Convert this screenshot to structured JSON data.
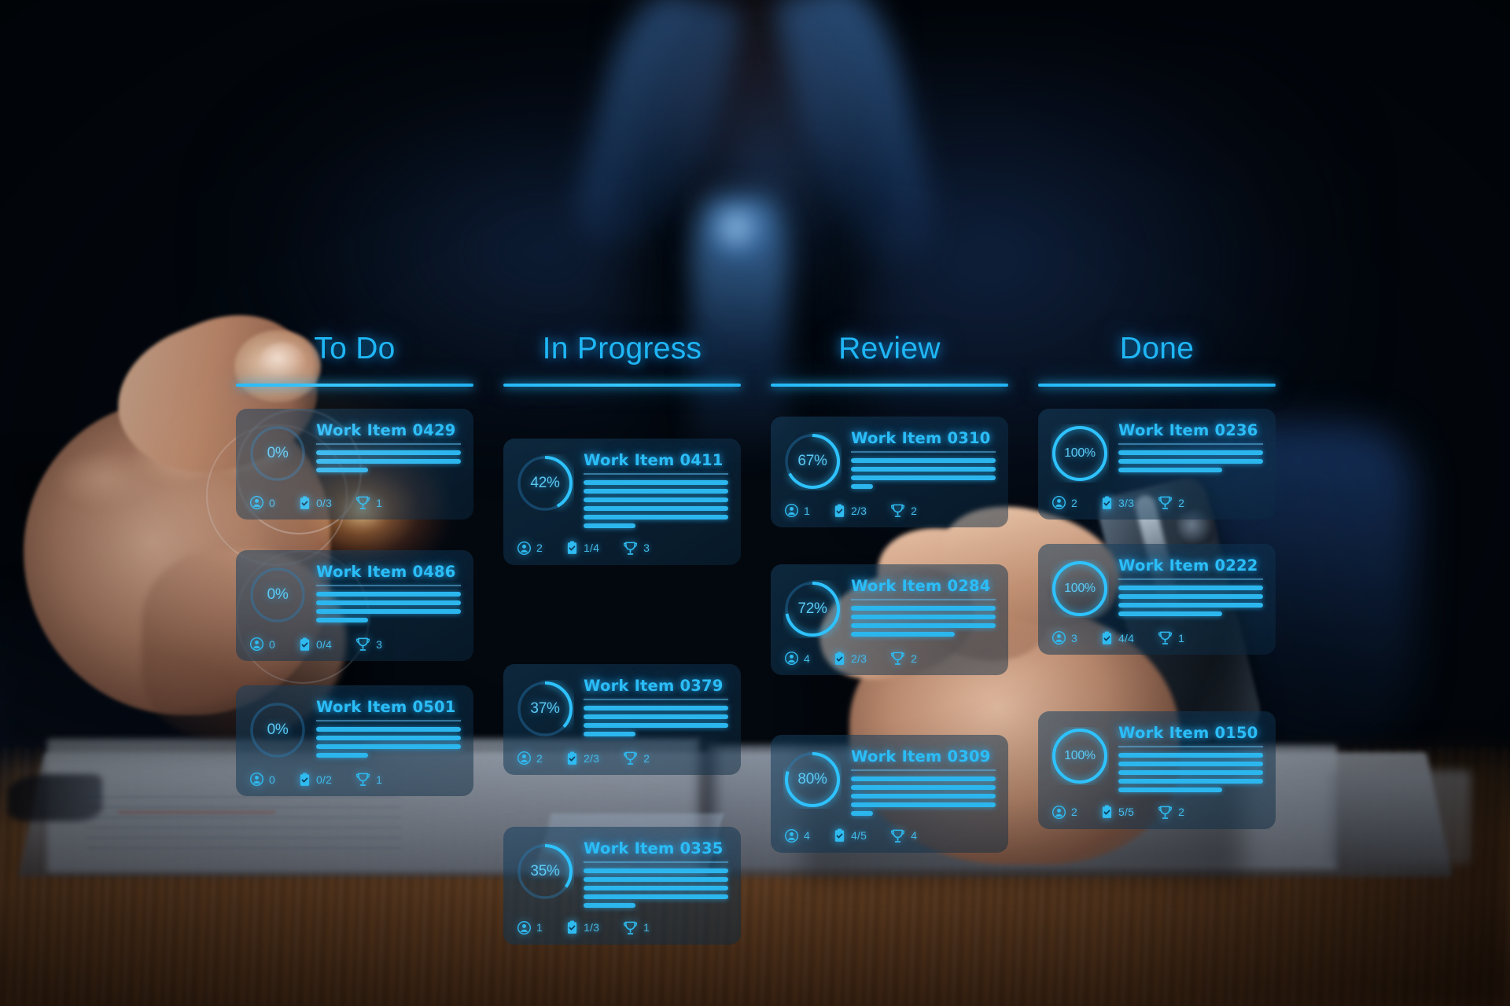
{
  "board": {
    "accent": "#2bbdf7",
    "columns": [
      {
        "id": "todo",
        "title": "To Do",
        "cards": [
          {
            "title": "Work Item 0429",
            "progress": 0,
            "progress_label": "0%",
            "lines": [
              "full",
              "full",
              "short"
            ],
            "assignees": "0",
            "checklist": "0/3",
            "awards": "1"
          },
          {
            "title": "Work Item 0486",
            "progress": 0,
            "progress_label": "0%",
            "lines": [
              "full",
              "full",
              "full",
              "short"
            ],
            "assignees": "0",
            "checklist": "0/4",
            "awards": "3"
          },
          {
            "title": "Work Item 0501",
            "progress": 0,
            "progress_label": "0%",
            "lines": [
              "full",
              "full",
              "full",
              "short"
            ],
            "assignees": "0",
            "checklist": "0/2",
            "awards": "1"
          }
        ]
      },
      {
        "id": "in-progress",
        "title": "In Progress",
        "cards": [
          {
            "title": "Work Item 0411",
            "progress": 42,
            "progress_label": "42%",
            "lines": [
              "full",
              "full",
              "full",
              "full",
              "full",
              "short"
            ],
            "assignees": "2",
            "checklist": "1/4",
            "awards": "3"
          },
          {
            "title": "Work Item 0379",
            "progress": 37,
            "progress_label": "37%",
            "lines": [
              "full",
              "full",
              "full",
              "short"
            ],
            "assignees": "2",
            "checklist": "2/3",
            "awards": "2"
          },
          {
            "title": "Work Item 0335",
            "progress": 35,
            "progress_label": "35%",
            "lines": [
              "full",
              "full",
              "full",
              "full",
              "short"
            ],
            "assignees": "1",
            "checklist": "1/3",
            "awards": "1"
          }
        ]
      },
      {
        "id": "review",
        "title": "Review",
        "cards": [
          {
            "title": "Work Item 0310",
            "progress": 67,
            "progress_label": "67%",
            "lines": [
              "full",
              "full",
              "full",
              "xshort"
            ],
            "assignees": "1",
            "checklist": "2/3",
            "awards": "2"
          },
          {
            "title": "Work Item 0284",
            "progress": 72,
            "progress_label": "72%",
            "lines": [
              "full",
              "full",
              "full",
              "mid"
            ],
            "assignees": "4",
            "checklist": "2/3",
            "awards": "2"
          },
          {
            "title": "Work Item 0309",
            "progress": 80,
            "progress_label": "80%",
            "lines": [
              "full",
              "full",
              "full",
              "full",
              "xshort"
            ],
            "assignees": "4",
            "checklist": "4/5",
            "awards": "4"
          }
        ]
      },
      {
        "id": "done",
        "title": "Done",
        "cards": [
          {
            "title": "Work Item 0236",
            "progress": 100,
            "progress_label": "100%",
            "lines": [
              "full",
              "full",
              "mid"
            ],
            "assignees": "2",
            "checklist": "3/3",
            "awards": "2"
          },
          {
            "title": "Work Item 0222",
            "progress": 100,
            "progress_label": "100%",
            "lines": [
              "full",
              "full",
              "full",
              "mid"
            ],
            "assignees": "3",
            "checklist": "4/4",
            "awards": "1"
          },
          {
            "title": "Work Item 0150",
            "progress": 100,
            "progress_label": "100%",
            "lines": [
              "full",
              "full",
              "full",
              "full",
              "mid"
            ],
            "assignees": "2",
            "checklist": "5/5",
            "awards": "2"
          }
        ]
      }
    ],
    "icons": {
      "assignee": "user-icon",
      "checklist": "clipboard-check-icon",
      "award": "trophy-icon"
    }
  }
}
